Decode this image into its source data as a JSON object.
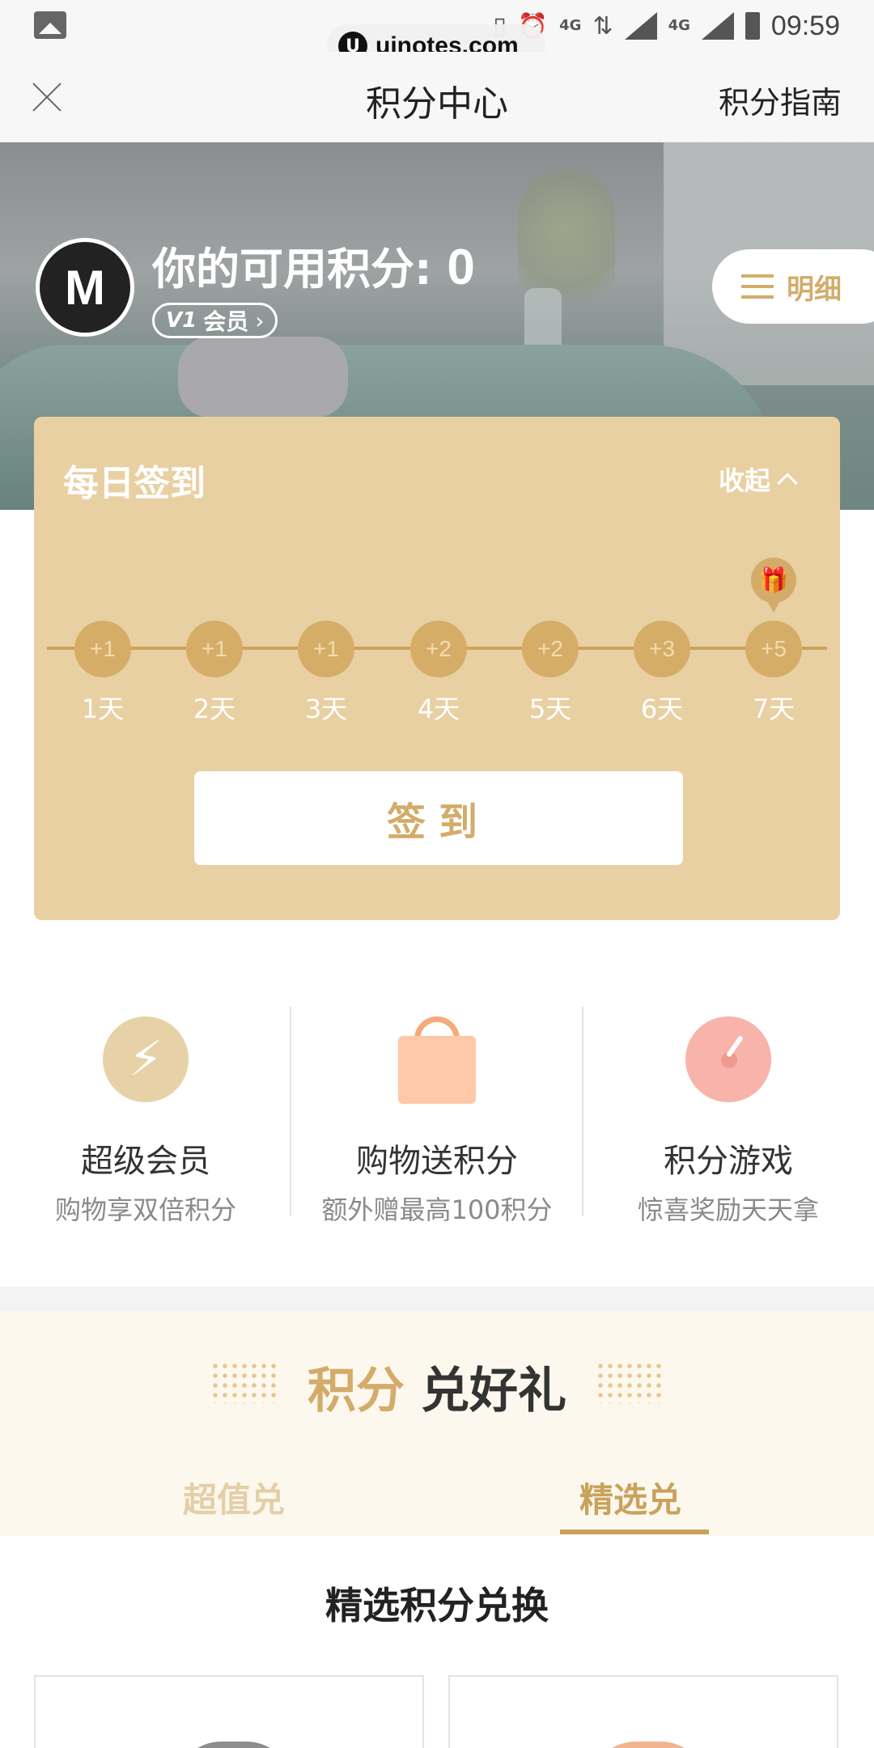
{
  "status_bar": {
    "time": "09:59",
    "network_1": "4G",
    "network_2": "4G",
    "icons": [
      "gallery-icon",
      "vibrate-icon",
      "alarm-icon",
      "data-arrows-icon",
      "signal-icon",
      "battery-icon"
    ]
  },
  "watermark": {
    "logo": "U",
    "text": "uinotes.com"
  },
  "nav": {
    "title": "积分中心",
    "guide": "积分指南",
    "close_icon": "close-icon"
  },
  "user": {
    "avatar_text": "M",
    "points_label": "你的可用积分:",
    "points_value": "0",
    "level": "V1",
    "member_label": "会员",
    "detail_label": "明细"
  },
  "checkin": {
    "title": "每日签到",
    "collapse_label": "收起",
    "days": [
      {
        "bonus": "+1",
        "label": "1天"
      },
      {
        "bonus": "+1",
        "label": "2天"
      },
      {
        "bonus": "+1",
        "label": "3天"
      },
      {
        "bonus": "+2",
        "label": "4天"
      },
      {
        "bonus": "+2",
        "label": "5天"
      },
      {
        "bonus": "+3",
        "label": "6天"
      },
      {
        "bonus": "+5",
        "label": "7天"
      }
    ],
    "button_label": "签到"
  },
  "features": [
    {
      "title": "超级会员",
      "subtitle": "购物享双倍积分",
      "icon": "lightning-icon"
    },
    {
      "title": "购物送积分",
      "subtitle": "额外赠最高100积分",
      "icon": "shopping-bag-icon"
    },
    {
      "title": "积分游戏",
      "subtitle": "惊喜奖励天天拿",
      "icon": "compass-icon"
    }
  ],
  "exchange": {
    "title_gold": "积分",
    "title_dark": "兑好礼",
    "tabs": [
      {
        "label": "超值兑",
        "active": false
      },
      {
        "label": "精选兑",
        "active": true
      }
    ],
    "section_title": "精选积分兑换"
  },
  "colors": {
    "gold": "#d3ac6a",
    "card_bg": "#e9d0a2",
    "cream": "#fdf8ee"
  }
}
